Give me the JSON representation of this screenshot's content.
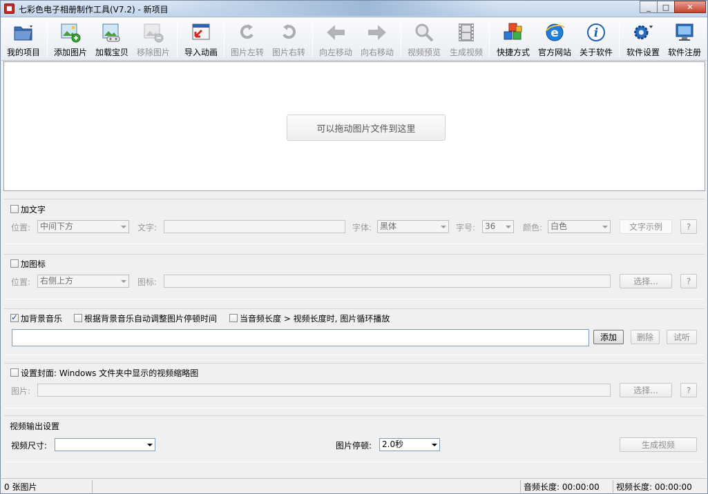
{
  "window": {
    "title": "七彩色电子相册制作工具(V7.2) - 新项目"
  },
  "toolbar": {
    "my_project": "我的项目",
    "add_picture": "添加图片",
    "load_baby": "加载宝贝",
    "remove_picture": "移除图片",
    "import_animation": "导入动画",
    "rotate_left": "图片左转",
    "rotate_right": "图片右转",
    "move_left": "向左移动",
    "move_right": "向右移动",
    "video_preview": "视频预览",
    "generate_video": "生成视频",
    "shortcut": "快捷方式",
    "official_site": "官方网站",
    "about": "关于软件",
    "settings": "软件设置",
    "register": "软件注册"
  },
  "dropzone": {
    "message": "可以拖动图片文件到这里"
  },
  "text_section": {
    "title": "加文字",
    "position_label": "位置:",
    "position_value": "中间下方",
    "text_label": "文字:",
    "font_label": "字体:",
    "font_value": "黑体",
    "size_label": "字号:",
    "size_value": "36",
    "color_label": "颜色:",
    "color_value": "白色",
    "sample_button": "文字示例",
    "help": "?"
  },
  "icon_section": {
    "title": "加图标",
    "position_label": "位置:",
    "position_value": "右侧上方",
    "icon_label": "图标:",
    "select_button": "选择...",
    "help": "?"
  },
  "music_section": {
    "title": "加背景音乐",
    "auto_adjust": "根据背景音乐自动调整图片停顿时间",
    "loop": "当音频长度 > 视频长度时, 图片循环播放",
    "add_button": "添加",
    "delete_button": "删除",
    "listen_button": "试听"
  },
  "cover_section": {
    "title": "设置封面: Windows 文件夹中显示的视频缩略图",
    "picture_label": "图片:",
    "select_button": "选择...",
    "help": "?"
  },
  "output_section": {
    "title": "视频输出设置",
    "size_label": "视频尺寸:",
    "size_value": "",
    "pause_label": "图片停顿:",
    "pause_value": "2.0秒",
    "generate_button": "生成视频"
  },
  "status": {
    "count": "0 张图片",
    "audio_length": "音频长度: 00:00:00",
    "video_length": "视频长度: 00:00:00"
  }
}
